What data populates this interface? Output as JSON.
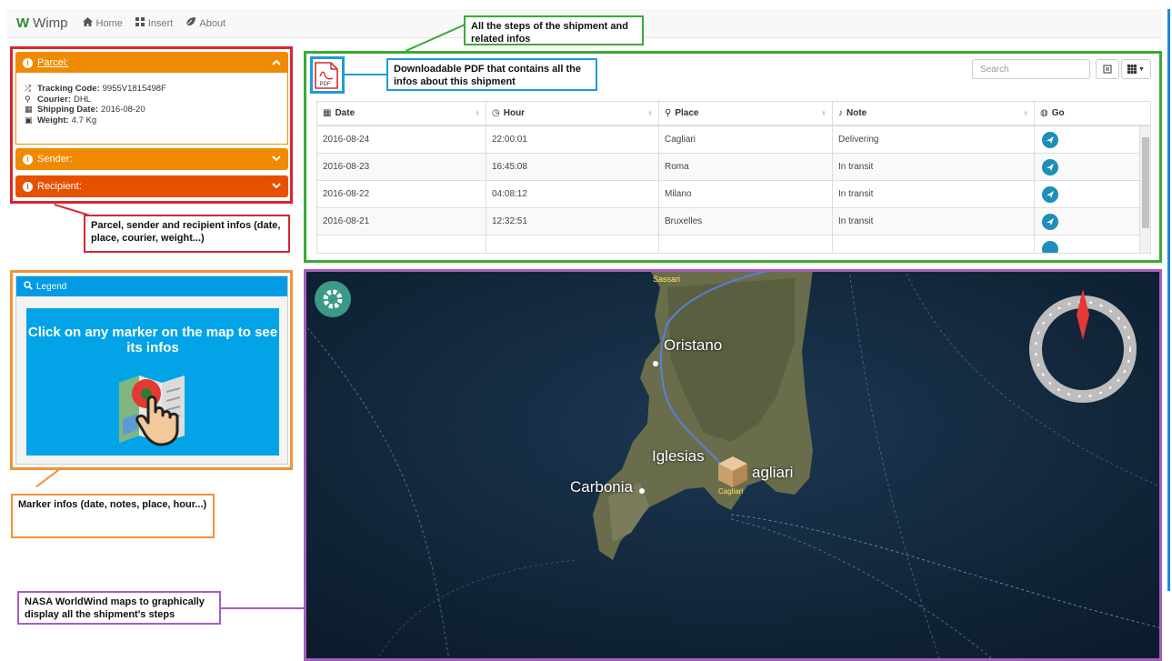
{
  "nav": {
    "brand": "Wimp",
    "items": [
      {
        "label": "Home",
        "icon": "home-icon"
      },
      {
        "label": "Insert",
        "icon": "grid-icon"
      },
      {
        "label": "About",
        "icon": "leaf-icon"
      }
    ]
  },
  "accordion": {
    "parcel_title": "Parcel:",
    "sender_title": "Sender:",
    "recipient_title": "Recipient:",
    "parcel_fields": [
      {
        "label": "Tracking Code:",
        "value": "9955V1815498F",
        "icon": "shuffle-icon"
      },
      {
        "label": "Courier:",
        "value": "DHL",
        "icon": "courier-icon"
      },
      {
        "label": "Shipping Date:",
        "value": "2016-08-20",
        "icon": "calendar-icon"
      },
      {
        "label": "Weight:",
        "value": "4.7 Kg",
        "icon": "weight-icon"
      }
    ]
  },
  "legend": {
    "title": "Legend",
    "text": "Click on any marker on the map to see its infos"
  },
  "table": {
    "search_placeholder": "Search",
    "pdf_label": "PDF",
    "columns": [
      "Date",
      "Hour",
      "Place",
      "Note",
      "Go"
    ],
    "rows": [
      {
        "date": "2016-08-24",
        "hour": "22:00:01",
        "place": "Cagliari",
        "note": "Delivering"
      },
      {
        "date": "2016-08-23",
        "hour": "16:45:08",
        "place": "Roma",
        "note": "In transit"
      },
      {
        "date": "2016-08-22",
        "hour": "04:08:12",
        "place": "Milano",
        "note": "In transit"
      },
      {
        "date": "2016-08-21",
        "hour": "12:32:51",
        "place": "Bruxelles",
        "note": "In transit"
      }
    ]
  },
  "map": {
    "labels": {
      "sassari": "Sassari",
      "oristano": "Oristano",
      "iglesias": "Iglesias",
      "carbonia": "Carbonia",
      "cagliari_big": "agliari",
      "cagliari_marker": "Cagliari"
    }
  },
  "annotations": {
    "steps": "All the steps of the shipment and related infos",
    "pdf": "Downloadable PDF that contains all the infos about this shipment",
    "parcel": "Parcel, sender and recipient infos (date, place, courier, weight...)",
    "marker": "Marker infos (date, notes, place, hour...)",
    "nasa": "NASA WorldWind maps to graphically display all the shipment's steps"
  },
  "colors": {
    "accent_orange": "#f08a00",
    "accent_red_orange": "#e65100",
    "accent_blue": "#039be5",
    "anno_green": "#3aaa35",
    "anno_red": "#d9262c",
    "anno_orange": "#f39237",
    "anno_blue": "#1a9ddb",
    "anno_purple": "#a65cc1"
  }
}
